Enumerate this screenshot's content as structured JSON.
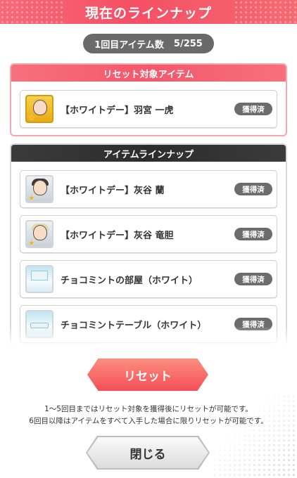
{
  "header": {
    "title": "現在のラインナップ"
  },
  "counter": {
    "label": "1回目アイテム数",
    "value": "5/255"
  },
  "reset_section": {
    "title": "リセット対象アイテム",
    "items": [
      {
        "name": "【ホワイトデー】羽宮 一虎",
        "status": "獲得済",
        "thumb": "character-card-icon"
      }
    ]
  },
  "lineup_section": {
    "title": "アイテムラインナップ",
    "items": [
      {
        "name": "【ホワイトデー】灰谷 蘭",
        "status": "獲得済",
        "thumb": "character-card-icon"
      },
      {
        "name": "【ホワイトデー】灰谷 竜胆",
        "status": "獲得済",
        "thumb": "character-card-icon"
      },
      {
        "name": "チョコミントの部屋（ホワイト）",
        "status": "獲得済",
        "thumb": "room-icon"
      },
      {
        "name": "チョコミントテーブル（ホワイト）",
        "status": "獲得済",
        "thumb": "table-icon"
      }
    ]
  },
  "buttons": {
    "reset": "リセット",
    "close": "閉じる"
  },
  "notes": [
    "1〜5回目まではリセット対象を獲得後にリセットが可能です。",
    "6回目以降はアイテムをすべて入手した場合に限りリセットが可能です。"
  ],
  "colors": {
    "accent_red": "#f54f64",
    "dark_header": "#2c2c2c",
    "badge_gray": "#6c6c6c"
  }
}
